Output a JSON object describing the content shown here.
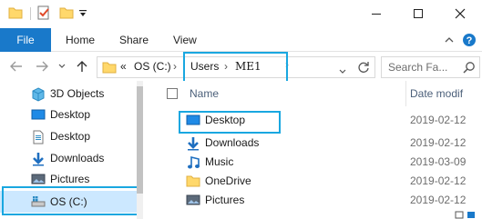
{
  "title_bar": {
    "icons": [
      "folder-icon",
      "properties-icon",
      "new-folder-icon",
      "customize-toolbar-icon"
    ],
    "controls": [
      "minimize-icon",
      "maximize-icon",
      "close-icon"
    ]
  },
  "ribbon": {
    "file_label": "File",
    "tabs": [
      "Home",
      "Share",
      "View"
    ]
  },
  "address_bar": {
    "overflow": "«",
    "drive": "OS (C:)",
    "separator": "›",
    "crumb_users": "Users",
    "crumb_user": "ME1",
    "search_placeholder": "Search Fa..."
  },
  "nav_pane": {
    "items": [
      {
        "label": "3D Objects",
        "icon": "3d-objects-icon"
      },
      {
        "label": "Desktop",
        "icon": "desktop-icon"
      },
      {
        "label": "Desktop",
        "icon": "document-icon"
      },
      {
        "label": "Downloads",
        "icon": "downloads-icon"
      },
      {
        "label": "Pictures",
        "icon": "pictures-icon"
      },
      {
        "label": "OS (C:)",
        "icon": "drive-icon"
      }
    ]
  },
  "file_list": {
    "columns": {
      "name": "Name",
      "date": "Date modif"
    },
    "rows": [
      {
        "name": "Desktop",
        "date": "2019-02-12",
        "icon": "desktop-folder-icon"
      },
      {
        "name": "Downloads",
        "date": "2019-02-12",
        "icon": "downloads-icon"
      },
      {
        "name": "Music",
        "date": "2019-03-09",
        "icon": "music-icon"
      },
      {
        "name": "OneDrive",
        "date": "2019-02-12",
        "icon": "folder-icon"
      },
      {
        "name": "Pictures",
        "date": "2019-02-12",
        "icon": "pictures-icon"
      }
    ]
  },
  "colors": {
    "accent": "#1979ca",
    "highlight": "#19a7e0",
    "selection": "#cce8ff",
    "folder_yellow": "#ffd86b"
  }
}
